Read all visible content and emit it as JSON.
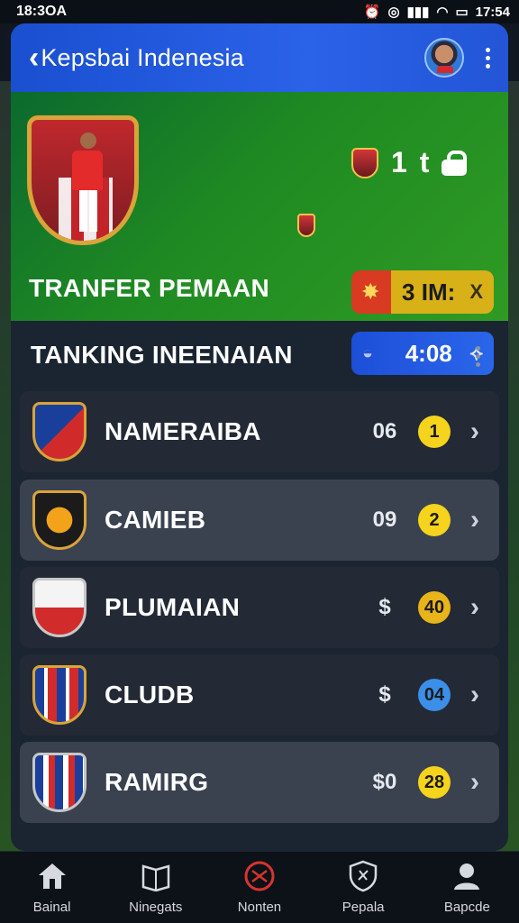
{
  "status_bar": {
    "left_text": "18:3OA",
    "time": "17:54"
  },
  "header": {
    "title": "Kepsbai Indenesia"
  },
  "hero": {
    "score_left": "1",
    "score_right": "t",
    "match_pill_value": "3 IM:",
    "match_pill_end": "X",
    "transfer_pill_value": "4:08",
    "title": "TRANFER PEMAAN"
  },
  "ranking": {
    "title": "TANKING INEENAIAN",
    "rows": [
      {
        "name": "NAMERAIBA",
        "stat": "06",
        "badge": "1",
        "badge_color": "#f6d31c",
        "alt": false
      },
      {
        "name": "CAMIEB",
        "stat": "09",
        "badge": "2",
        "badge_color": "#f6d31c",
        "alt": true
      },
      {
        "name": "PLUMAIAN",
        "stat": "$",
        "badge": "40",
        "badge_color": "#e7b41a",
        "alt": false
      },
      {
        "name": "CLUDB",
        "stat": "$",
        "badge": "04",
        "badge_color": "#3b8fe8",
        "alt": false
      },
      {
        "name": "RAMIRG",
        "stat": "$0",
        "badge": "28",
        "badge_color": "#f6d31c",
        "alt": true
      }
    ]
  },
  "tabs": [
    {
      "label": "Bainal",
      "icon": "home-icon"
    },
    {
      "label": "Ninegats",
      "icon": "book-icon"
    },
    {
      "label": "Nonten",
      "icon": "ball-icon"
    },
    {
      "label": "Pepala",
      "icon": "shield-icon"
    },
    {
      "label": "Bapcde",
      "icon": "profile-icon"
    }
  ],
  "colors": {
    "accent_blue": "#2a62e8",
    "pitch_green": "#1f8a22",
    "gold": "#d9a43a"
  }
}
